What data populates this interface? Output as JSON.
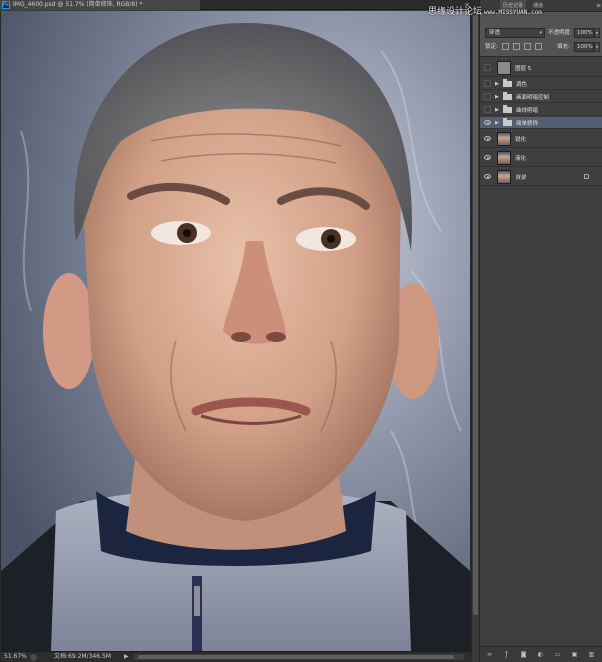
{
  "document": {
    "title": "IMG_4600.psd @ 51.7% (简单修饰, RGB/8) *",
    "close": "×"
  },
  "statusbar": {
    "zoom": "51.67%",
    "doc_info": "文档:69.2M/346.5M",
    "menu_glyph": "▶"
  },
  "panel": {
    "tabs": [
      "历史记录",
      "通道"
    ],
    "menu_glyph": "≡",
    "blend_mode": "穿透",
    "opacity_label": "不透明度:",
    "opacity_value": "100%",
    "lock_label": "锁定:",
    "fill_label": "填充:",
    "fill_value": "100%"
  },
  "layers": [
    {
      "name": "图层 5",
      "kind": "pixel",
      "visible": false,
      "selected": false
    },
    {
      "name": "调色",
      "kind": "group",
      "visible": false,
      "selected": false
    },
    {
      "name": "画面明暗控制",
      "kind": "group",
      "visible": false,
      "selected": false
    },
    {
      "name": "曲线明暗",
      "kind": "group",
      "visible": false,
      "selected": false
    },
    {
      "name": "简单修饰",
      "kind": "group",
      "visible": true,
      "selected": true
    },
    {
      "name": "锐化",
      "kind": "pixel",
      "visible": true,
      "selected": false
    },
    {
      "name": "液化",
      "kind": "pixel",
      "visible": true,
      "selected": false
    },
    {
      "name": "背景",
      "kind": "background",
      "visible": true,
      "selected": false,
      "locked": true
    }
  ],
  "footer_icons": [
    "link-icon",
    "fx-icon",
    "mask-icon",
    "adjustment-icon",
    "folder-icon",
    "new-layer-icon",
    "trash-icon"
  ],
  "watermark": {
    "text": "思缘设计论坛",
    "url": "www.MISSYUAN.com"
  }
}
